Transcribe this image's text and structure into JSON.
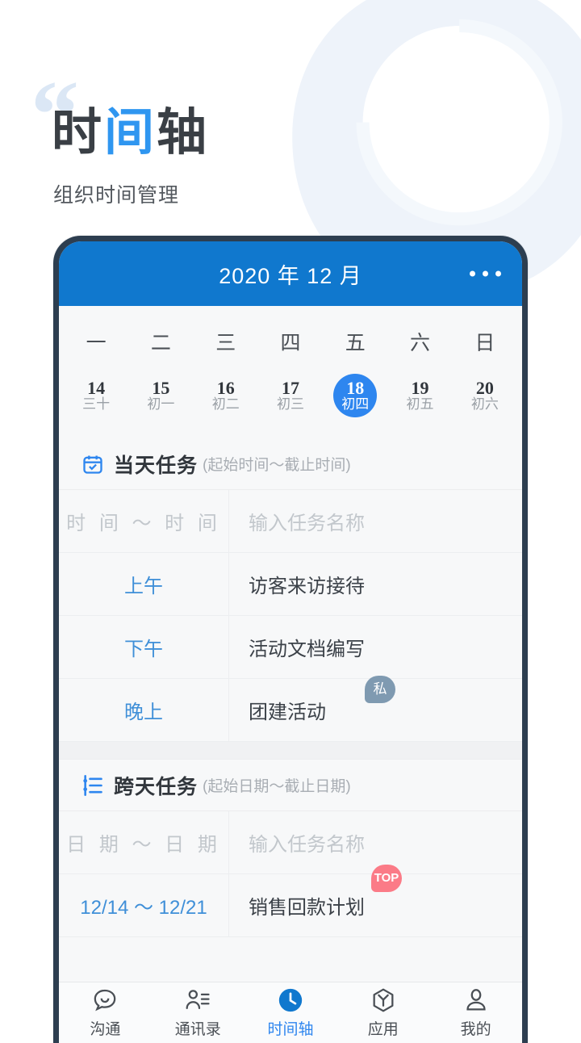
{
  "promo": {
    "quote_mark": "“",
    "title_part1": "时",
    "title_accent": "间",
    "title_part2": "轴",
    "title_full": "时间轴",
    "subtitle": "组织时间管理"
  },
  "colors": {
    "app_bar_blue": "#1078CE",
    "accent_blue": "#2E86EF",
    "link_blue": "#3F8FD8",
    "phone_frame": "#2D3E50",
    "screen_bg": "#F7F8F9",
    "badge_private": "#7F9AB1",
    "badge_top": "#FB7B87",
    "watermark": "#EAF1FA"
  },
  "app_bar": {
    "title": "2020 年 12 月",
    "more_icon": "more-horizontal-icon"
  },
  "calendar": {
    "weekdays": [
      "一",
      "二",
      "三",
      "四",
      "五",
      "六",
      "日"
    ],
    "days": [
      {
        "num": "14",
        "lunar": "三十",
        "selected": false
      },
      {
        "num": "15",
        "lunar": "初一",
        "selected": false
      },
      {
        "num": "16",
        "lunar": "初二",
        "selected": false
      },
      {
        "num": "17",
        "lunar": "初三",
        "selected": false
      },
      {
        "num": "18",
        "lunar": "初四",
        "selected": true
      },
      {
        "num": "19",
        "lunar": "初五",
        "selected": false
      },
      {
        "num": "20",
        "lunar": "初六",
        "selected": false
      }
    ]
  },
  "today_section": {
    "icon": "calendar-check-icon",
    "title": "当天任务",
    "hint": "(起始时间～截止时间)",
    "input_row": {
      "time_placeholder": "时 间 ～ 时 间",
      "name_placeholder": "输入任务名称"
    },
    "tasks": [
      {
        "time": "上午",
        "name": "访客来访接待",
        "badge": ""
      },
      {
        "time": "下午",
        "name": "活动文档编写",
        "badge": ""
      },
      {
        "time": "晚上",
        "name": "团建活动",
        "badge": "私"
      }
    ]
  },
  "multiday_section": {
    "icon": "sliders-icon",
    "title": "跨天任务",
    "hint": "(起始日期～截止日期)",
    "input_row": {
      "date_placeholder": "日 期 ～ 日 期",
      "name_placeholder": "输入任务名称"
    },
    "tasks": [
      {
        "time": "12/14 ～ 12/21",
        "name": "销售回款计划",
        "badge": "TOP"
      }
    ]
  },
  "bottom_nav": {
    "items": [
      {
        "label": "沟通",
        "icon": "chat-bubble-icon",
        "active": false
      },
      {
        "label": "通讯录",
        "icon": "contacts-icon",
        "active": false
      },
      {
        "label": "时间轴",
        "icon": "clock-icon",
        "active": true
      },
      {
        "label": "应用",
        "icon": "hexagon-apps-icon",
        "active": false
      },
      {
        "label": "我的",
        "icon": "person-icon",
        "active": false
      }
    ]
  }
}
